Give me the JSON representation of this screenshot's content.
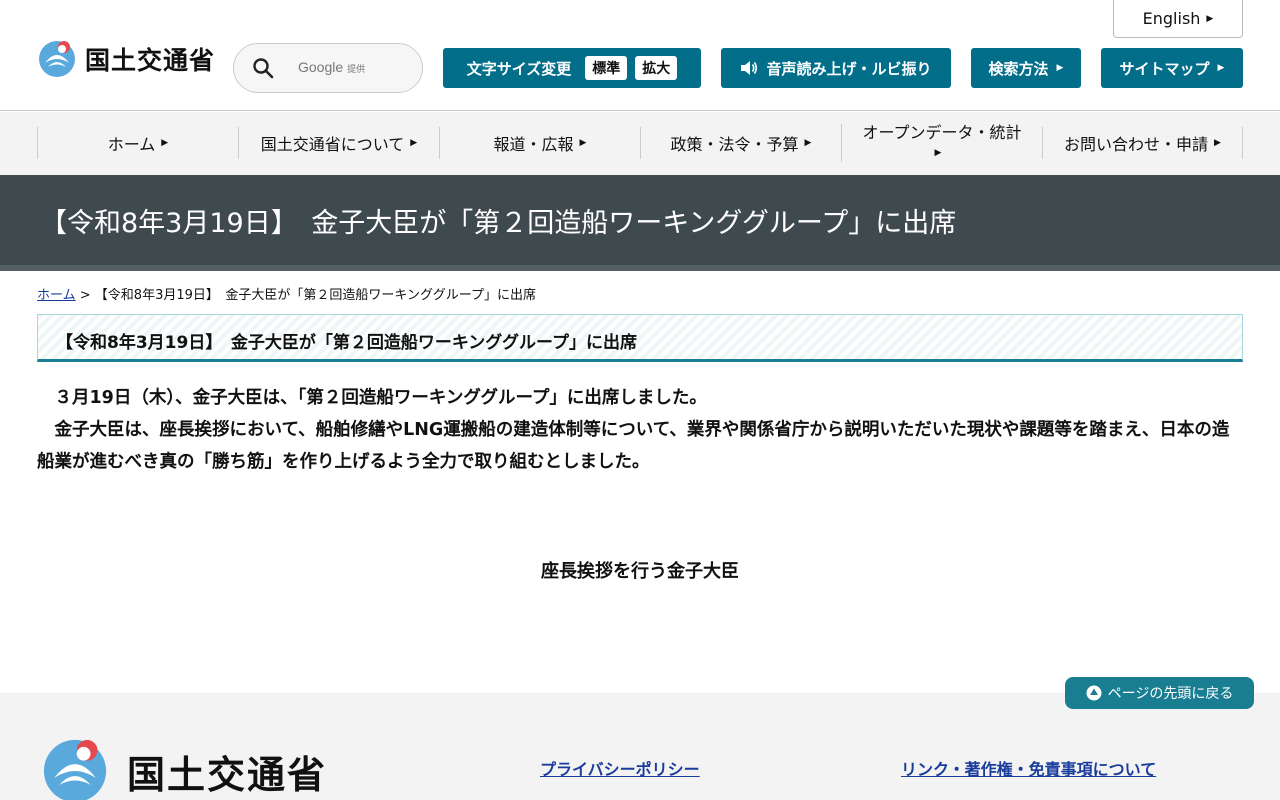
{
  "header": {
    "english_label": "English",
    "logo_text": "国土交通省",
    "search": {
      "google_label": "Google",
      "provided_label": "提供"
    },
    "font_size": {
      "label": "文字サイズ変更",
      "standard": "標準",
      "large": "拡大"
    },
    "speech_label": "音声読み上げ・ルビ振り",
    "search_method_label": "検索方法",
    "sitemap_label": "サイトマップ"
  },
  "nav": {
    "items": [
      {
        "label": "ホーム"
      },
      {
        "label": "国土交通省について"
      },
      {
        "label": "報道・広報"
      },
      {
        "label": "政策・法令・予算"
      },
      {
        "label": "オープンデータ・統計"
      },
      {
        "label": "お問い合わせ・申請"
      }
    ]
  },
  "page": {
    "title": "【令和8年3月19日】　金子大臣が「第２回造船ワーキンググループ」に出席",
    "breadcrumb_home": "ホーム",
    "breadcrumb_sep": " > ",
    "breadcrumb_current": "【令和8年3月19日】　金子大臣が「第２回造船ワーキンググループ」に出席",
    "section_heading": "【令和8年3月19日】　金子大臣が「第２回造船ワーキンググループ」に出席",
    "paragraph_1": "　３月19日（木）、金子大臣は、「第２回造船ワーキンググループ」に出席しました。",
    "paragraph_2": "　金子大臣は、座長挨拶において、船舶修繕やLNG運搬船の建造体制等について、業界や関係省庁から説明いただいた現状や課題等を踏まえ、日本の造船業が進むべき真の「勝ち筋」を作り上げるよう全力で取り組むとしました。",
    "photo_caption": "座長挨拶を行う金子大臣"
  },
  "footer": {
    "back_to_top": "ページの先頭に戻る",
    "logo_text": "国土交通省",
    "privacy_link": "プライバシーポリシー",
    "link_copyright": "リンク・著作権・免責事項について"
  },
  "colors": {
    "brand_teal": "#036e8a",
    "banner_dark": "#3f4a4f",
    "link_blue": "#1a3d9c"
  }
}
